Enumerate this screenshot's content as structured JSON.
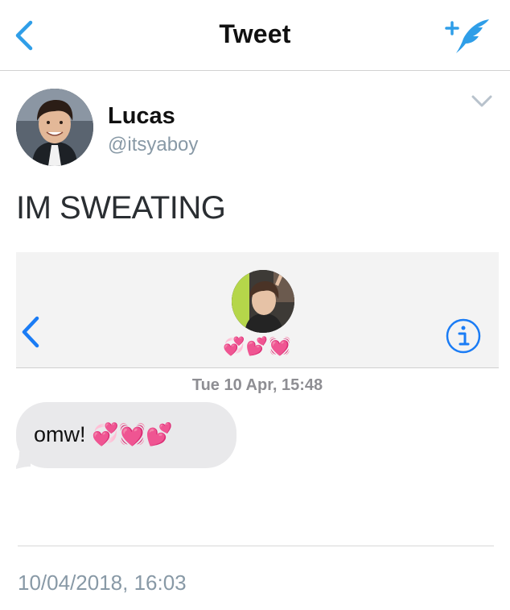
{
  "navbar": {
    "title": "Tweet",
    "back_icon": "chevron-left-icon",
    "compose_icon": "compose-quill-icon",
    "accent_color": "#2f9ee8"
  },
  "tweet": {
    "author_name": "Lucas",
    "author_handle": "@itsyaboy",
    "text": "IM SWEATING",
    "timestamp": "10/04/2018, 16:03",
    "menu_icon": "chevron-down-icon"
  },
  "screenshot": {
    "contact_emoji": "💞💕💓",
    "message_time": "Tue 10 Apr, 15:48",
    "message_text": "omw! 💞💓💕",
    "info_icon": "info-icon",
    "back_icon": "chevron-left-icon",
    "link_color": "#1a7cf5"
  }
}
